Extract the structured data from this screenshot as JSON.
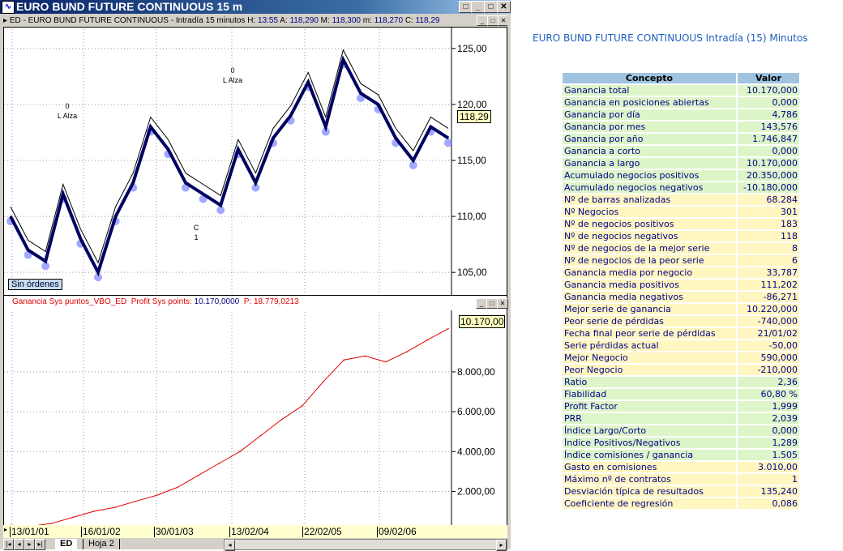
{
  "window": {
    "title": "EURO BUND FUTURE CONTINUOUS 15 m",
    "btn_restore": "□",
    "btn_min": "_",
    "btn_max": "□",
    "btn_close": "✕"
  },
  "subheader": {
    "prefix": "ED - EURO BUND FUTURE CONTINUOUS - Intradía 15 minutos",
    "h_label": "H:",
    "h": "13:55",
    "a_label": "A:",
    "a": "118,290",
    "m_label": "M:",
    "m": "118,300",
    "mn_label": "m:",
    "mn": "118,270",
    "c_label": "C:",
    "c": "118,29"
  },
  "price_panel": {
    "last_price": "118,29",
    "badge": "Sin órdenes",
    "annotations": [
      "0",
      "L Alza",
      "0",
      "L Alza",
      "C",
      "1"
    ]
  },
  "equity_panel": {
    "legend_name": "Ganancia Sys puntos_VBO_ED",
    "legend_label": "Profit Sys points:",
    "legend_value": "10.170,0000",
    "legend_p": "P: 18.779,0213",
    "last_value": "10.170,00"
  },
  "chart_data": [
    {
      "type": "line",
      "title": "EURO BUND FUTURE CONTINUOUS 15 m",
      "ylim": [
        104,
        126
      ],
      "yticks": [
        "125,00",
        "120,00",
        "115,00",
        "110,00",
        "105,00"
      ],
      "ytick_values": [
        125,
        120,
        115,
        110,
        105
      ],
      "x": [
        0,
        1,
        2,
        3,
        4,
        5,
        6,
        7,
        8,
        9,
        10,
        11,
        12,
        13,
        14,
        15,
        16,
        17,
        18,
        19,
        20,
        21,
        22,
        23,
        24,
        25
      ],
      "values": [
        110,
        107,
        106,
        112,
        108,
        105,
        110,
        113,
        118,
        116,
        113,
        112,
        111,
        116,
        113,
        117,
        119,
        122,
        118,
        124,
        121,
        120,
        117,
        115,
        118,
        117
      ]
    },
    {
      "type": "line",
      "title": "Ganancia Sys puntos_VBO_ED",
      "ylim": [
        -300,
        10600
      ],
      "yticks": [
        "8.000,00",
        "6.000,00",
        "4.000,00",
        "2.000,00"
      ],
      "ytick_values": [
        8000,
        6000,
        4000,
        2000
      ],
      "x": [
        0,
        1,
        2,
        3,
        4,
        5,
        6,
        7,
        8,
        9,
        10,
        11,
        12,
        13,
        14,
        15,
        16,
        17,
        18,
        19,
        20,
        21
      ],
      "values": [
        300,
        250,
        400,
        700,
        1000,
        1200,
        1500,
        1800,
        2200,
        2800,
        3400,
        4000,
        4800,
        5600,
        6300,
        7500,
        8600,
        8800,
        8500,
        9000,
        9600,
        10170
      ]
    }
  ],
  "date_axis": [
    "13/01/01",
    "16/01/02",
    "30/01/03",
    "13/02/04",
    "22/02/05",
    "09/02/06"
  ],
  "tabs": {
    "active": "ED",
    "other": "Hoja 2"
  },
  "report": {
    "title": "EURO BUND FUTURE CONTINUOUS Intradía (15) Minutos",
    "col_concept": "Concepto",
    "col_value": "Valor",
    "rows": [
      {
        "c": "Ganancia total",
        "v": "10.170,000",
        "k": "g"
      },
      {
        "c": "Ganancia en posiciones abiertas",
        "v": "0,000",
        "k": "g"
      },
      {
        "c": "Ganancia por día",
        "v": "4,786",
        "k": "g"
      },
      {
        "c": "Ganancia por mes",
        "v": "143,576",
        "k": "g"
      },
      {
        "c": "Ganancia por año",
        "v": "1.746,847",
        "k": "g"
      },
      {
        "c": "Ganancia a corto",
        "v": "0,000",
        "k": "g"
      },
      {
        "c": "Ganancia a largo",
        "v": "10.170,000",
        "k": "g"
      },
      {
        "c": "Acumulado negocios positivos",
        "v": "20.350,000",
        "k": "g"
      },
      {
        "c": "Acumulado negocios negativos",
        "v": "-10.180,000",
        "k": "g"
      },
      {
        "c": "Nº de barras analizadas",
        "v": "68.284",
        "k": "y"
      },
      {
        "c": "Nº Negocios",
        "v": "301",
        "k": "y"
      },
      {
        "c": "Nº de negocios positivos",
        "v": "183",
        "k": "y"
      },
      {
        "c": "Nº de negocios negativos",
        "v": "118",
        "k": "y"
      },
      {
        "c": "Nº de negocios de la mejor serie",
        "v": "8",
        "k": "y"
      },
      {
        "c": "Nº de negocios de la peor serie",
        "v": "6",
        "k": "y"
      },
      {
        "c": "Ganancia media por negocio",
        "v": "33,787",
        "k": "y"
      },
      {
        "c": "Ganancia media positivos",
        "v": "111,202",
        "k": "y"
      },
      {
        "c": "Ganancia media negativos",
        "v": "-86,271",
        "k": "y"
      },
      {
        "c": "Mejor serie de ganancia",
        "v": "10.220,000",
        "k": "y"
      },
      {
        "c": "Peor serie de pérdidas",
        "v": "-740,000",
        "k": "y"
      },
      {
        "c": "Fecha final peor serie de pérdidas",
        "v": "21/01/02",
        "k": "y"
      },
      {
        "c": "Serie pérdidas actual",
        "v": "-50,00",
        "k": "y"
      },
      {
        "c": "Mejor Negocio",
        "v": "590,000",
        "k": "y"
      },
      {
        "c": "Peor Negocio",
        "v": "-210,000",
        "k": "y"
      },
      {
        "c": "Ratio",
        "v": "2,36",
        "k": "g"
      },
      {
        "c": "Fiabilidad",
        "v": "60,80 %",
        "k": "g"
      },
      {
        "c": "Profit Factor",
        "v": "1,999",
        "k": "g"
      },
      {
        "c": "PRR",
        "v": "2,039",
        "k": "g"
      },
      {
        "c": "Índice Largo/Corto",
        "v": "0,000",
        "k": "g"
      },
      {
        "c": "Índice Positivos/Negativos",
        "v": "1,289",
        "k": "g"
      },
      {
        "c": "Índice comisiones / ganancia",
        "v": "1.505",
        "k": "g"
      },
      {
        "c": "Gasto en comisiones",
        "v": "3.010,00",
        "k": "y"
      },
      {
        "c": "Máximo nº de contratos",
        "v": "1",
        "k": "y"
      },
      {
        "c": "Desviación típica de resultados",
        "v": "135,240",
        "k": "y"
      },
      {
        "c": "Coeficiente de regresión",
        "v": "0,086",
        "k": "y"
      }
    ]
  }
}
